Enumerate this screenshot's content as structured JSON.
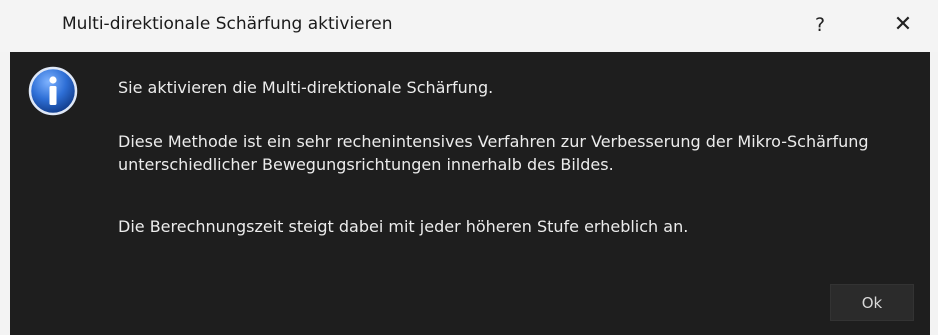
{
  "dialog": {
    "title": "Multi-direktionale Schärfung aktivieren",
    "help_label": "?",
    "close_label": "✕",
    "icon": "info-icon",
    "message_line1": "Sie aktivieren die Multi-direktionale Schärfung.",
    "message_line2": "Diese Methode ist ein sehr rechenintensives Verfahren zur Verbesserung der Mikro-Schärfung unterschiedlicher Bewegungsrichtungen innerhalb des Bildes.",
    "message_line3": "Die Berechnungszeit steigt dabei mit jeder höheren Stufe erheblich an.",
    "ok_label": "Ok"
  },
  "colors": {
    "content_bg": "#1e1e1e",
    "titlebar_bg": "#f4f4f4",
    "text": "#ececec",
    "icon_blue": "#1a5fc4"
  }
}
